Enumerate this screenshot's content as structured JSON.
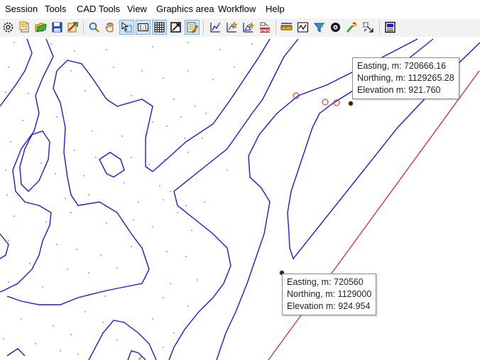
{
  "menu": {
    "items": [
      {
        "id": "session",
        "label": "Session"
      },
      {
        "id": "tools",
        "label": "Tools"
      },
      {
        "id": "cad-tools",
        "label": "CAD Tools"
      },
      {
        "id": "view",
        "label": "View"
      },
      {
        "id": "graphics-area",
        "label": "Graphics area"
      },
      {
        "id": "workflow",
        "label": "Workflow"
      },
      {
        "id": "help",
        "label": "Help"
      }
    ]
  },
  "toolbar": {
    "buttons": [
      {
        "name": "settings-gear-icon",
        "active": false
      },
      {
        "name": "new-document-icon",
        "active": false
      },
      {
        "name": "open-folder-icon",
        "active": false
      },
      {
        "name": "save-disk-icon",
        "active": false
      },
      {
        "name": "export-icon",
        "active": false
      },
      {
        "name": "zoom-magnifier-icon",
        "active": false
      },
      {
        "name": "pan-hand-icon",
        "active": false
      },
      {
        "name": "select-pick-icon",
        "active": true
      },
      {
        "name": "zoom-1-1-icon",
        "active": true
      },
      {
        "name": "grid-icon",
        "active": true
      },
      {
        "name": "fit-extent-icon",
        "active": false
      },
      {
        "name": "edit-layer-icon",
        "active": true
      },
      {
        "name": "contour-lines-icon",
        "active": false
      },
      {
        "name": "add-points-icon",
        "active": false
      },
      {
        "name": "triangulate-icon",
        "active": false
      },
      {
        "name": "dwg-export-icon",
        "active": false
      },
      {
        "name": "measure-ruler-icon",
        "active": false
      },
      {
        "name": "profile-chart-icon",
        "active": false
      },
      {
        "name": "filter-funnel-icon",
        "active": false
      },
      {
        "name": "target-cog-icon",
        "active": false
      },
      {
        "name": "path-wand-icon",
        "active": false
      },
      {
        "name": "transform-icon",
        "active": false
      },
      {
        "name": "properties-panel-icon",
        "active": false
      }
    ]
  },
  "tooltips": [
    {
      "id": "point-a",
      "easting": "Easting, m: 720666.16",
      "northing": "Northing, m: 1129265.28",
      "elevation": "Elevation m: 921.760"
    },
    {
      "id": "point-b",
      "easting": "Easting, m: 720560",
      "northing": "Northing, m: 1129000",
      "elevation": "Elevation m: 924.954"
    }
  ],
  "colors": {
    "contour": "#1a1adb",
    "boundary": "#e01818",
    "survey_point": "#3a8fd6",
    "active_button": "#cde6f7"
  }
}
